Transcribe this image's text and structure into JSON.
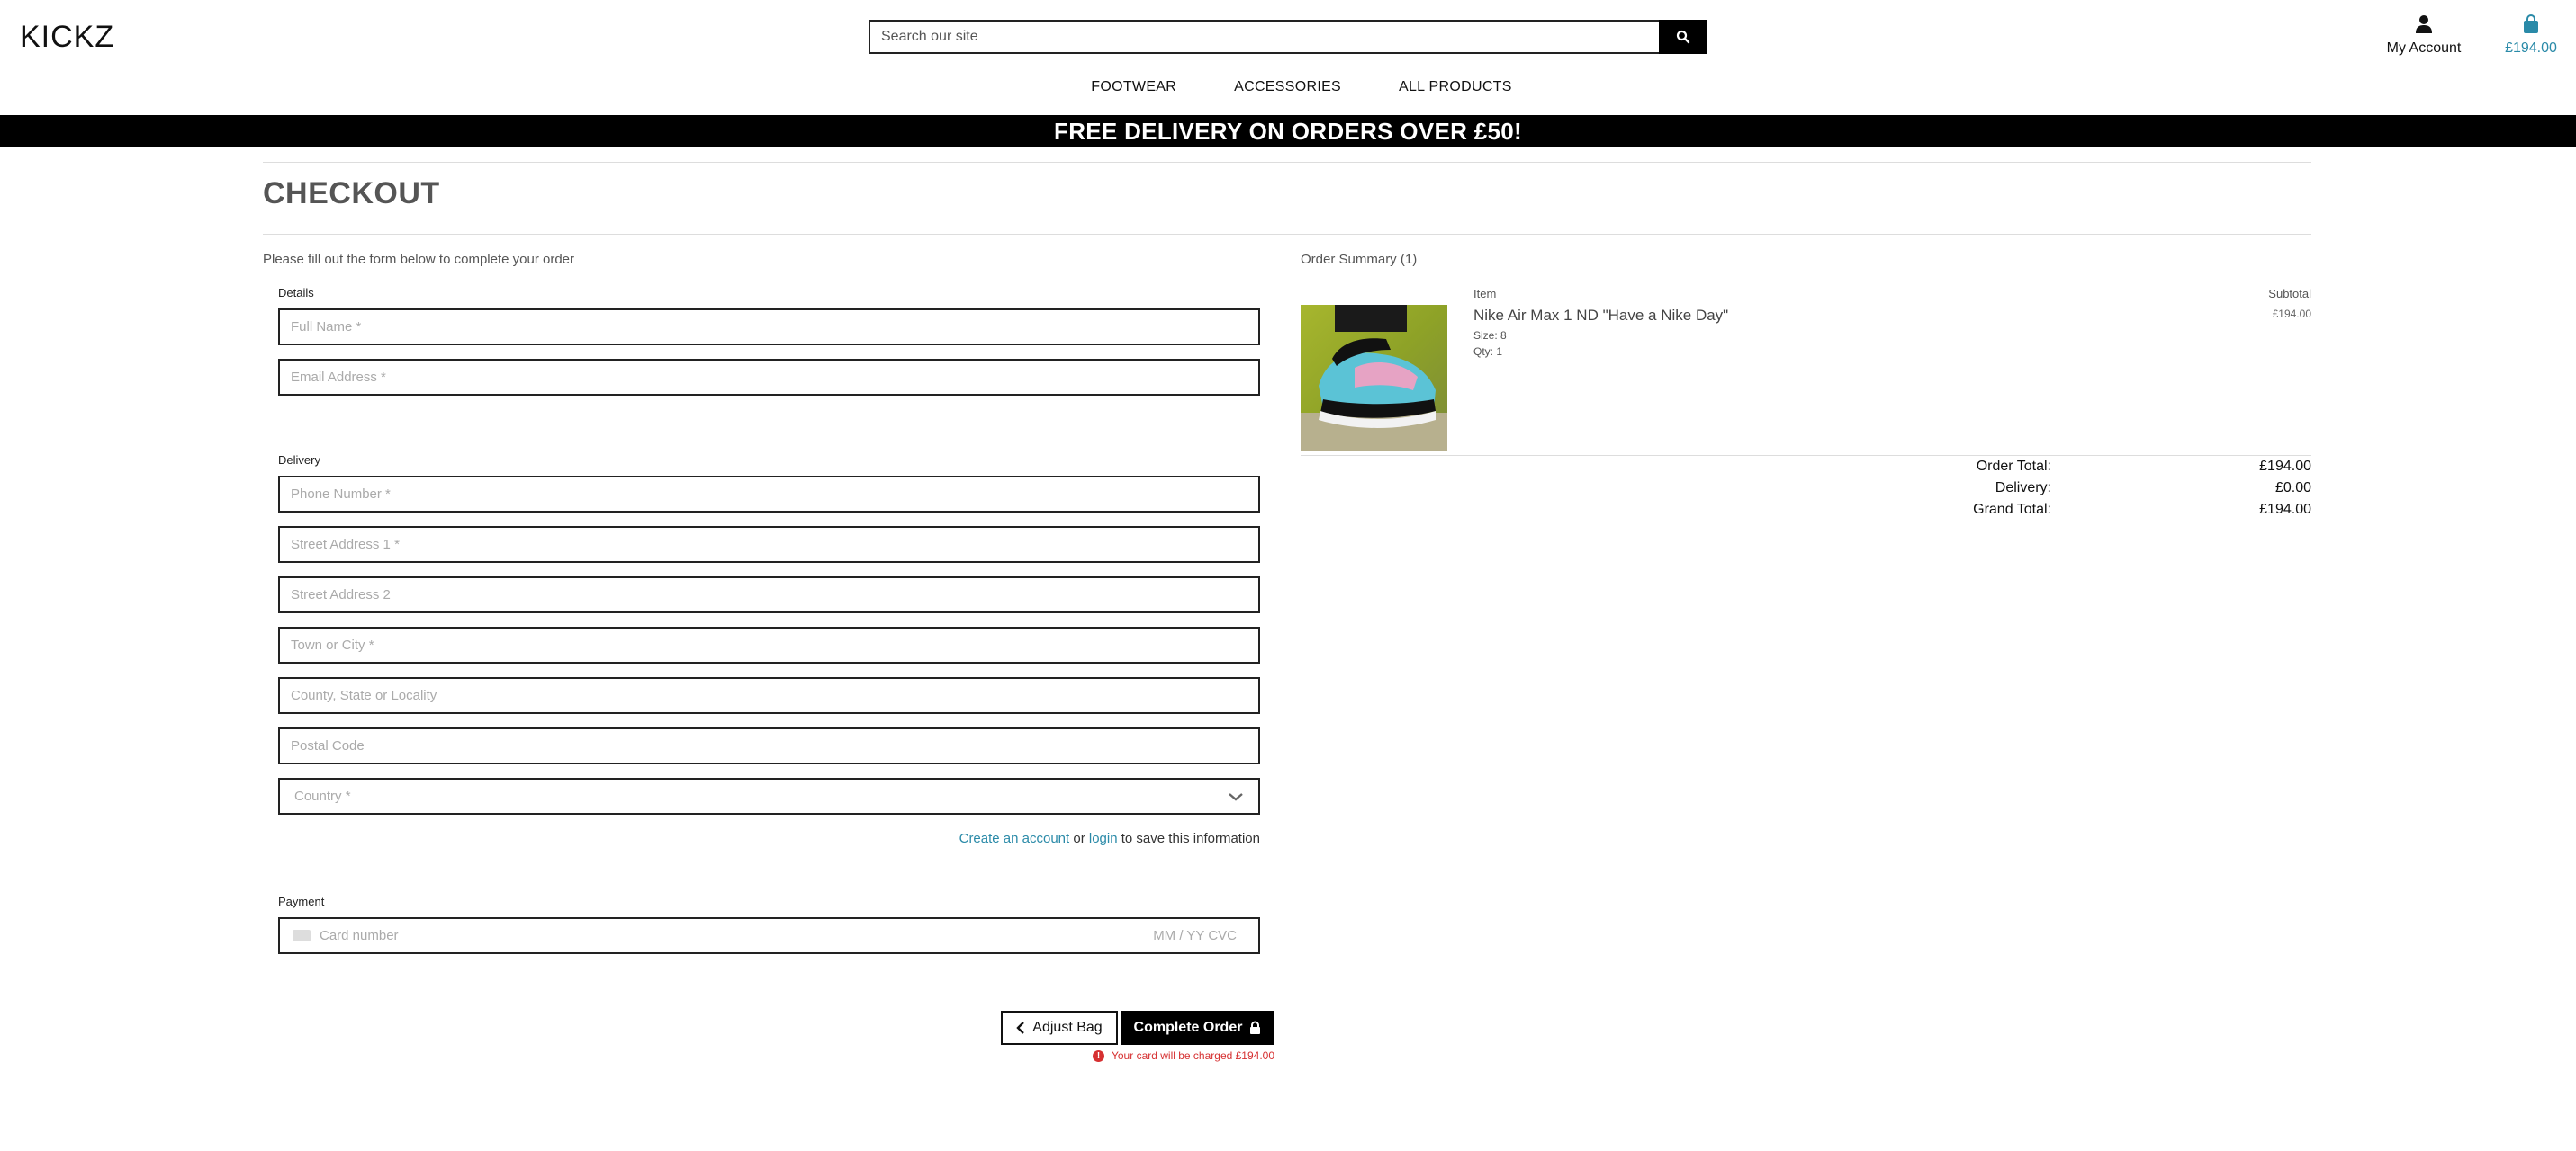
{
  "header": {
    "brand": "KICKZ",
    "search_placeholder": "Search our site",
    "account_label": "My Account",
    "bag_amount": "£194.00"
  },
  "nav": {
    "items": [
      {
        "label": "FOOTWEAR"
      },
      {
        "label": "ACCESSORIES"
      },
      {
        "label": "ALL PRODUCTS"
      }
    ]
  },
  "banner": {
    "text": "FREE DELIVERY ON ORDERS OVER £50!"
  },
  "checkout": {
    "title": "CHECKOUT",
    "intro": "Please fill out the form below to complete your order",
    "details_label": "Details",
    "full_name_placeholder": "Full Name *",
    "email_placeholder": "Email Address *",
    "delivery_label": "Delivery",
    "phone_placeholder": "Phone Number *",
    "street1_placeholder": "Street Address 1 *",
    "street2_placeholder": "Street Address 2",
    "town_placeholder": "Town or City *",
    "county_placeholder": "County, State or Locality",
    "postcode_placeholder": "Postal Code",
    "country_placeholder": "Country *",
    "save_create_link": "Create an account",
    "save_or": "or",
    "save_login_link": "login",
    "save_suffix": "to save this information",
    "payment_label": "Payment",
    "card_placeholder": "Card number",
    "card_extra": "MM / YY  CVC",
    "adjust_bag_label": "Adjust Bag",
    "complete_order_label": "Complete Order",
    "charge_note": "Your card will be charged £194.00"
  },
  "summary": {
    "title": "Order Summary (1)",
    "col_item": "Item",
    "col_subtotal": "Subtotal",
    "product": {
      "name": "Nike Air Max 1 ND \"Have a Nike Day\"",
      "size": "Size: 8",
      "qty": "Qty: 1",
      "subtotal": "£194.00"
    },
    "order_total_label": "Order Total:",
    "order_total_value": "£194.00",
    "delivery_label": "Delivery:",
    "delivery_value": "£0.00",
    "grand_total_label": "Grand Total:",
    "grand_total_value": "£194.00"
  },
  "icons": {
    "search": "search-icon",
    "account": "user-icon",
    "bag": "shopping-bag-icon",
    "chevron_left": "chevron-left-icon",
    "lock": "lock-icon",
    "alert": "alert-icon",
    "card": "credit-card-icon",
    "chevron_down": "chevron-down-icon"
  },
  "colors": {
    "accent_link": "#2a8aa8",
    "error": "#d63031",
    "banner_bg": "#000000"
  }
}
